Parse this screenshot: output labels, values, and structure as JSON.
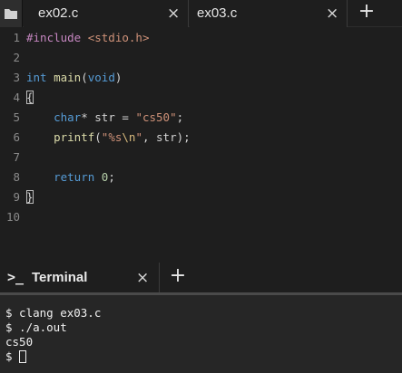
{
  "tabs": [
    {
      "label": "ex02.c",
      "close": "×"
    },
    {
      "label": "ex03.c",
      "close": "×"
    }
  ],
  "add_tab": "+",
  "icons": {
    "folder": "folder-icon",
    "terminal": "terminal-prompt-icon"
  },
  "editor": {
    "lines": [
      {
        "num": "1",
        "tokens": [
          {
            "t": "#include ",
            "c": "pp"
          },
          {
            "t": "<stdio.h>",
            "c": "inc"
          }
        ]
      },
      {
        "num": "2",
        "tokens": []
      },
      {
        "num": "3",
        "tokens": [
          {
            "t": "int ",
            "c": "kw"
          },
          {
            "t": "main",
            "c": "fn"
          },
          {
            "t": "(",
            "c": "op"
          },
          {
            "t": "void",
            "c": "kw"
          },
          {
            "t": ")",
            "c": "op"
          }
        ]
      },
      {
        "num": "4",
        "tokens": [
          {
            "t": "{",
            "c": "op cur-bracket"
          }
        ]
      },
      {
        "num": "5",
        "tokens": [
          {
            "t": "    char",
            "c": "kw"
          },
          {
            "t": "* str = ",
            "c": "op"
          },
          {
            "t": "\"cs50\"",
            "c": "str"
          },
          {
            "t": ";",
            "c": "op"
          }
        ]
      },
      {
        "num": "6",
        "tokens": [
          {
            "t": "    printf",
            "c": "fn"
          },
          {
            "t": "(",
            "c": "op"
          },
          {
            "t": "\"%s",
            "c": "str"
          },
          {
            "t": "\\n",
            "c": "esc"
          },
          {
            "t": "\"",
            "c": "str"
          },
          {
            "t": ", str);",
            "c": "op"
          }
        ]
      },
      {
        "num": "7",
        "tokens": []
      },
      {
        "num": "8",
        "tokens": [
          {
            "t": "    return ",
            "c": "kw"
          },
          {
            "t": "0",
            "c": "num"
          },
          {
            "t": ";",
            "c": "op"
          }
        ]
      },
      {
        "num": "9",
        "tokens": [
          {
            "t": "}",
            "c": "op cur-bracket"
          }
        ]
      },
      {
        "num": "10",
        "tokens": []
      }
    ]
  },
  "terminal": {
    "tab_label": "Terminal",
    "prompt_glyph": ">_",
    "close": "×",
    "add": "+",
    "lines": [
      "$ clang ex03.c",
      "$ ./a.out",
      "cs50",
      "$ "
    ]
  }
}
